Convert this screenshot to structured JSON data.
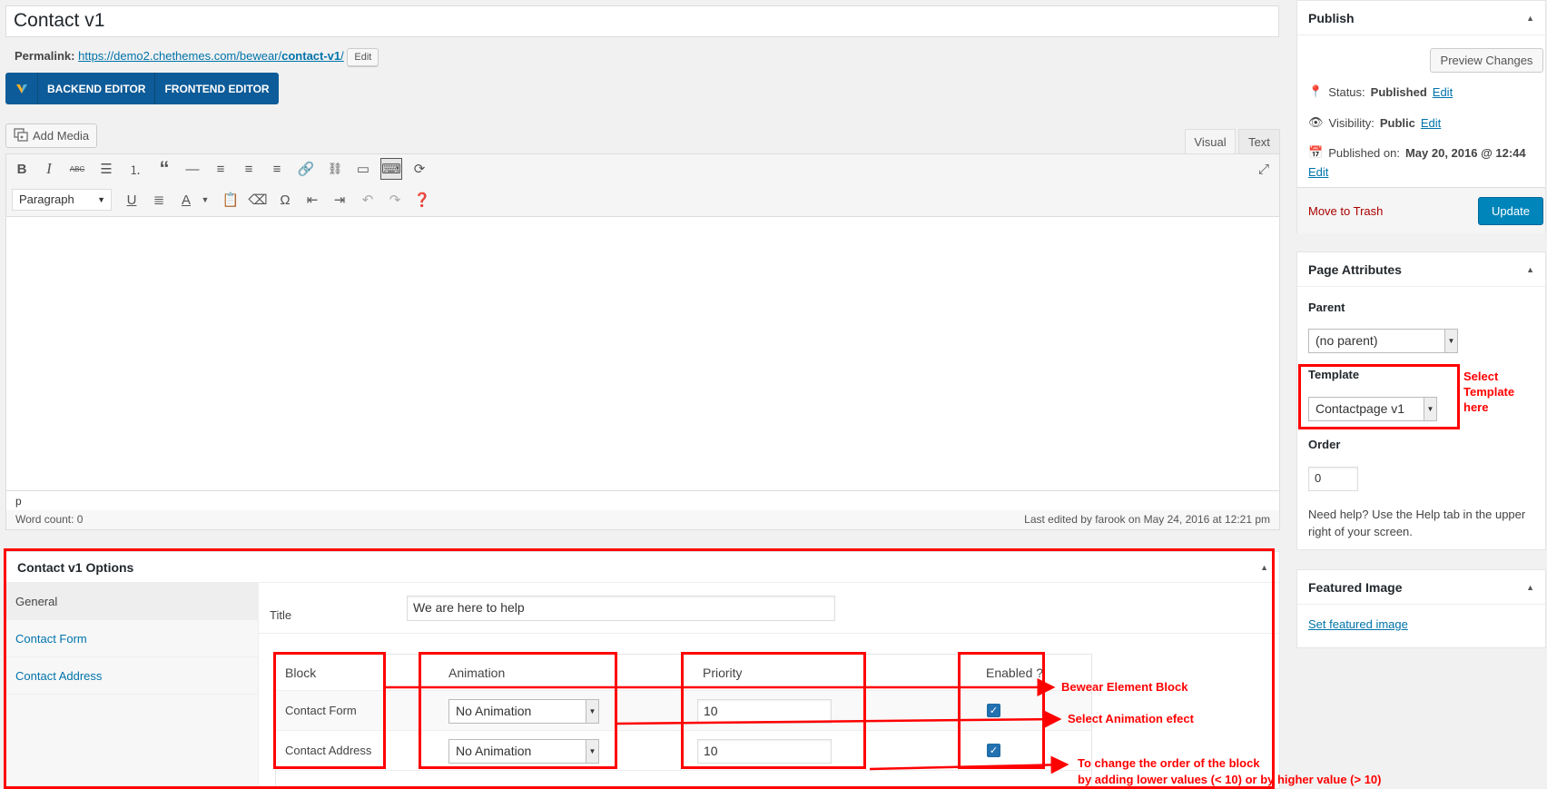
{
  "post": {
    "title": "Contact v1",
    "permalink_label": "Permalink:",
    "permalink_base": "https://demo2.chethemes.com/bewear/",
    "permalink_slug": "contact-v1",
    "permalink_trail": "/",
    "edit_label": "Edit"
  },
  "vc": {
    "backend": "BACKEND EDITOR",
    "frontend": "FRONTEND EDITOR"
  },
  "editor": {
    "add_media": "Add Media",
    "tab_visual": "Visual",
    "tab_text": "Text",
    "format": "Paragraph",
    "path": "p",
    "word_count": "Word count: 0",
    "last_edited": "Last edited by farook on May 24, 2016 at 12:21 pm"
  },
  "publish": {
    "title": "Publish",
    "preview": "Preview Changes",
    "status_label": "Status:",
    "status_value": "Published",
    "visibility_label": "Visibility:",
    "visibility_value": "Public",
    "published_label": "Published on:",
    "published_value": "May 20, 2016 @ 12:44",
    "edit": "Edit",
    "trash": "Move to Trash",
    "update": "Update"
  },
  "attributes": {
    "title": "Page Attributes",
    "parent_label": "Parent",
    "parent_value": "(no parent)",
    "template_label": "Template",
    "template_value": "Contactpage v1",
    "order_label": "Order",
    "order_value": "0",
    "help": "Need help? Use the Help tab in the upper right of your screen."
  },
  "featured": {
    "title": "Featured Image",
    "link": "Set featured image"
  },
  "options": {
    "title": "Contact v1 Options",
    "tabs": [
      "General",
      "Contact Form",
      "Contact Address"
    ],
    "title_label": "Title",
    "title_value": "We are here to help",
    "headers": [
      "Block",
      "Animation",
      "Priority",
      "Enabled ?"
    ],
    "rows": [
      {
        "block": "Contact Form",
        "animation": "No Animation",
        "priority": "10"
      },
      {
        "block": "Contact Address",
        "animation": "No Animation",
        "priority": "10"
      }
    ]
  },
  "annotations": {
    "template": "Select Template here",
    "block": "Bewear Element Block",
    "animation": "Select Animation efect",
    "order_line1": "To change the order of the block",
    "order_line2": "by adding  lower values (< 10)  or by higher value (> 10)"
  },
  "colors": {
    "annotation": "#ff0000",
    "primary": "#0085ba",
    "vc": "#0d5b98",
    "link": "#0073aa"
  }
}
